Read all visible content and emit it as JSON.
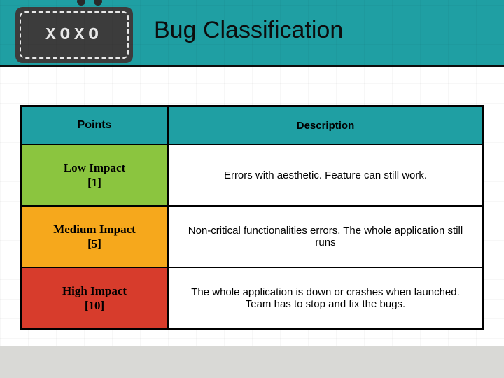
{
  "brand": "XOXO",
  "title": "Bug Classification",
  "table": {
    "headers": {
      "points": "Points",
      "description": "Description"
    },
    "rows": [
      {
        "label": "Low Impact",
        "points": "[1]",
        "description": "Errors with aesthetic. Feature can still work."
      },
      {
        "label": "Medium Impact",
        "points": "[5]",
        "description": "Non-critical functionalities errors. The whole application still runs"
      },
      {
        "label": "High Impact",
        "points": "[10]",
        "description": "The whole application is down or crashes when launched. Team has to stop and fix the bugs."
      }
    ]
  },
  "colors": {
    "teal": "#1f9fa3",
    "low": "#8bc53f",
    "medium": "#f6a81c",
    "high": "#d73c2c",
    "tag": "#3c3c3c",
    "footer": "#d9d9d6"
  }
}
